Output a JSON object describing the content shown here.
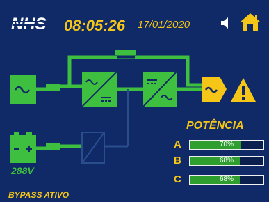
{
  "header": {
    "logo": "NHS",
    "time": "08:05:26",
    "date": "17/01/2020"
  },
  "battery": {
    "voltage": "288V"
  },
  "power": {
    "title": "POTÊNCIA",
    "phases": [
      {
        "label": "A",
        "value_text": "70%",
        "value": 70
      },
      {
        "label": "B",
        "value_text": "68%",
        "value": 68
      },
      {
        "label": "C",
        "value_text": "68%",
        "value": 68
      }
    ]
  },
  "status": {
    "text": "BYPASS ATIVO"
  },
  "colors": {
    "background": "#0f2a66",
    "active_green": "#3fbf3f",
    "accent_yellow": "#f5c518",
    "inactive": "#2a4d8c"
  },
  "icons": [
    "sound-icon",
    "home-icon",
    "warning-icon"
  ]
}
